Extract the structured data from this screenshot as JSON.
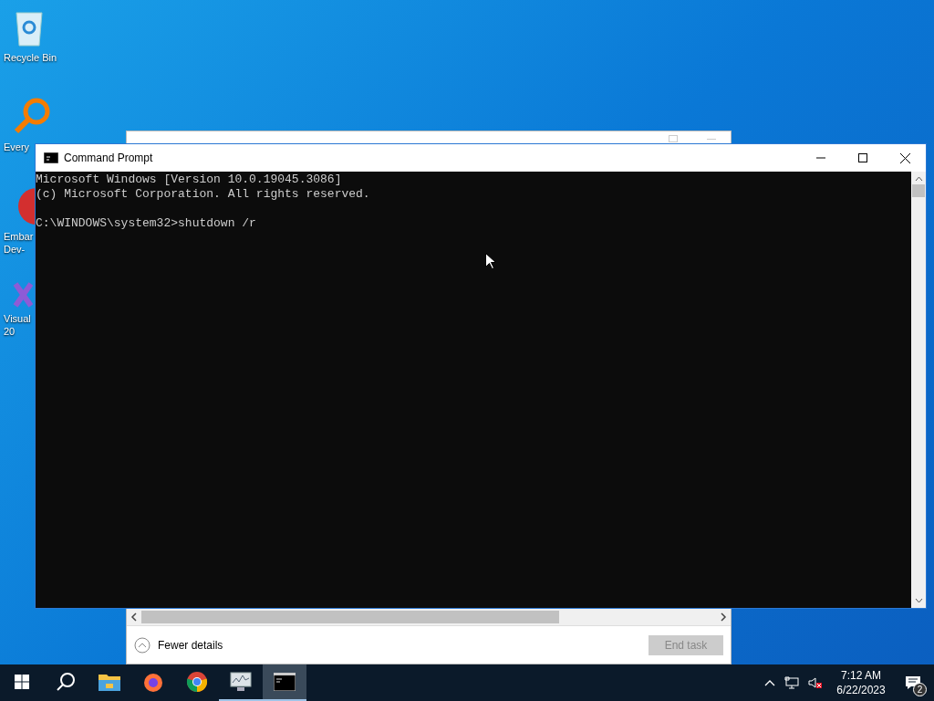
{
  "desktop_icons": [
    {
      "kind": "recycle",
      "label_lines": [
        "Recycle Bin"
      ]
    },
    {
      "kind": "search-app",
      "label_lines": [
        "Every"
      ]
    },
    {
      "kind": "dev",
      "label_lines": [
        "Embar",
        "Dev-"
      ]
    },
    {
      "kind": "visual",
      "label_lines": [
        "Visual",
        "20"
      ]
    }
  ],
  "task_manager": {
    "fewer_details": "Fewer details",
    "end_task": {
      "label": "End task",
      "disabled": true
    }
  },
  "command_prompt": {
    "title": "Command Prompt",
    "blocks": [
      [
        "Microsoft Windows [Version 10.0.19045.3086]",
        "(c) Microsoft Corporation. All rights reserved."
      ],
      [
        "C:\\WINDOWS\\system32>shutdown /r"
      ]
    ]
  },
  "taskbar": {
    "apps": [
      {
        "kind": "start",
        "selected": false,
        "running": false
      },
      {
        "kind": "search",
        "selected": false,
        "running": false
      },
      {
        "kind": "explorer",
        "selected": false,
        "running": false
      },
      {
        "kind": "firefox",
        "selected": false,
        "running": false
      },
      {
        "kind": "chrome",
        "selected": false,
        "running": false
      },
      {
        "kind": "taskmgr",
        "selected": false,
        "running": true
      },
      {
        "kind": "cmd",
        "selected": true,
        "running": true
      }
    ],
    "time": "7:12 AM",
    "date": "6/22/2023",
    "notifications": "2"
  }
}
